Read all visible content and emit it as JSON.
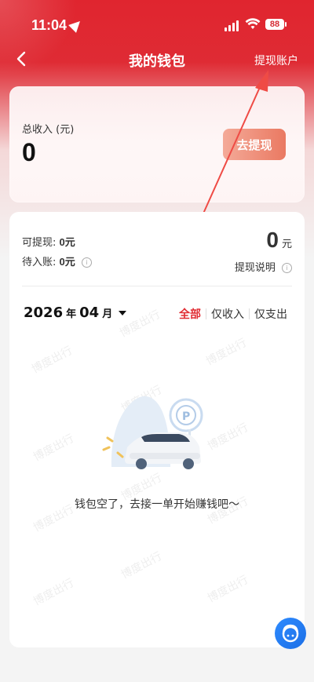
{
  "status_bar": {
    "time": "11:04",
    "battery": "88"
  },
  "nav": {
    "title": "我的钱包",
    "right_link": "提现账户"
  },
  "income_card": {
    "label": "总收入 (元)",
    "value": "0",
    "withdraw_button": "去提现"
  },
  "summary": {
    "withdrawable_label": "可提现:",
    "withdrawable_value": "0元",
    "pending_label": "待入账:",
    "pending_value": "0元",
    "total_value": "0",
    "total_unit": "元",
    "explain_label": "提现说明"
  },
  "filter": {
    "year": "2026",
    "year_suffix": "年",
    "month": "04",
    "month_suffix": "月",
    "options": [
      "全部",
      "仅收入",
      "仅支出"
    ],
    "active": "全部"
  },
  "empty_state": {
    "text": "钱包空了，去接一单开始赚钱吧～"
  },
  "watermark_text": "博度出行",
  "colors": {
    "brand_red": "#e0252f",
    "accent_blue": "#2e8bff"
  },
  "icons": [
    "back-arrow-icon",
    "location-arrow-icon",
    "signal-icon",
    "wifi-icon",
    "info-icon",
    "dropdown-caret-icon",
    "parking-icon",
    "customer-service-icon"
  ]
}
